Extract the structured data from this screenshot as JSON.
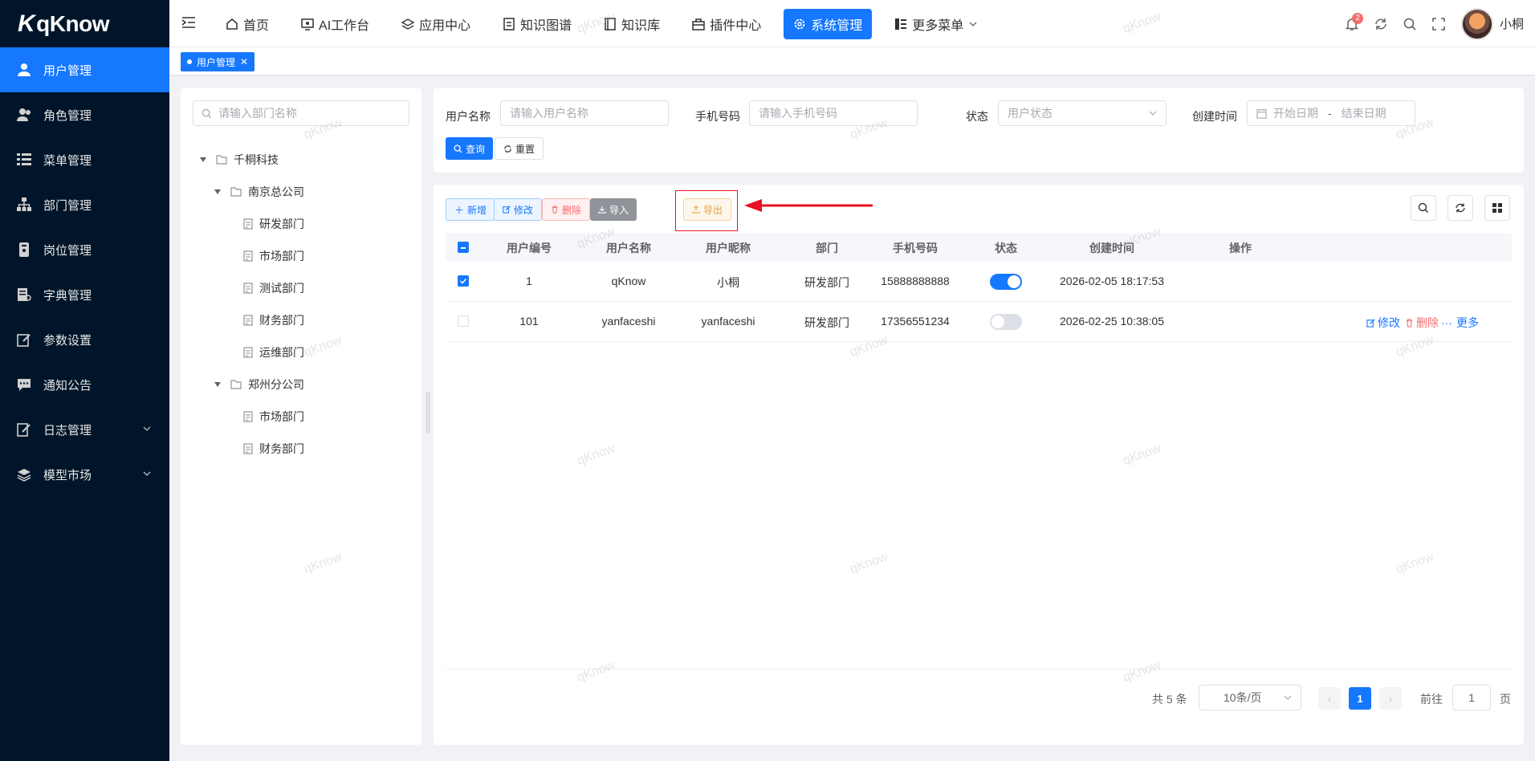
{
  "brand": {
    "name": "qKnow",
    "mark": "K"
  },
  "sidebar": {
    "items": [
      {
        "label": "用户管理",
        "icon": "user-icon",
        "active": true
      },
      {
        "label": "角色管理",
        "icon": "role-icon"
      },
      {
        "label": "菜单管理",
        "icon": "menu-list-icon"
      },
      {
        "label": "部门管理",
        "icon": "org-tree-icon"
      },
      {
        "label": "岗位管理",
        "icon": "post-icon"
      },
      {
        "label": "字典管理",
        "icon": "dictionary-icon"
      },
      {
        "label": "参数设置",
        "icon": "edit-icon"
      },
      {
        "label": "通知公告",
        "icon": "message-icon"
      },
      {
        "label": "日志管理",
        "icon": "log-icon",
        "expandable": true
      },
      {
        "label": "模型市场",
        "icon": "model-icon",
        "expandable": true
      }
    ]
  },
  "topnav": {
    "items": [
      {
        "label": "首页",
        "icon": "home-icon"
      },
      {
        "label": "AI工作台",
        "icon": "monitor-icon"
      },
      {
        "label": "应用中心",
        "icon": "app-icon"
      },
      {
        "label": "知识图谱",
        "icon": "graph-icon"
      },
      {
        "label": "知识库",
        "icon": "book-icon"
      },
      {
        "label": "插件中心",
        "icon": "plugin-icon"
      },
      {
        "label": "系统管理",
        "icon": "gear-icon",
        "active": true
      },
      {
        "label": "更多菜单",
        "icon": "grid-menu-icon"
      }
    ],
    "notification_count": "2",
    "username": "小桐"
  },
  "tabs": {
    "active": "用户管理"
  },
  "tree": {
    "search_placeholder": "请输入部门名称",
    "root": "千桐科技",
    "groups": [
      {
        "label": "南京总公司",
        "children": [
          "研发部门",
          "市场部门",
          "测试部门",
          "财务部门",
          "运维部门"
        ]
      },
      {
        "label": "郑州分公司",
        "children": [
          "市场部门",
          "财务部门"
        ]
      }
    ]
  },
  "search": {
    "username_label": "用户名称",
    "username_placeholder": "请输入用户名称",
    "phone_label": "手机号码",
    "phone_placeholder": "请输入手机号码",
    "status_label": "状态",
    "status_placeholder": "用户状态",
    "created_label": "创建时间",
    "start_placeholder": "开始日期",
    "range_sep": "-",
    "end_placeholder": "结束日期",
    "query_btn": "查询",
    "reset_btn": "重置"
  },
  "toolbar": {
    "add": "新增",
    "edit": "修改",
    "delete": "删除",
    "import": "导入",
    "export": "导出"
  },
  "table": {
    "columns": [
      "用户编号",
      "用户名称",
      "用户昵称",
      "部门",
      "手机号码",
      "状态",
      "创建时间",
      "操作"
    ],
    "rows": [
      {
        "id": "1",
        "username": "qKnow",
        "nickname": "小桐",
        "dept": "研发部门",
        "phone": "15888888888",
        "enabled": true,
        "created": "2026-02-05 18:17:53",
        "checked": true,
        "ops": false
      },
      {
        "id": "101",
        "username": "yanfaceshi",
        "nickname": "yanfaceshi",
        "dept": "研发部门",
        "phone": "17356551234",
        "enabled": false,
        "created": "2026-02-25 10:38:05",
        "checked": false,
        "ops": true
      }
    ],
    "op_edit": "修改",
    "op_delete": "删除",
    "op_more": "更多"
  },
  "pagination": {
    "total_text": "共 5 条",
    "page_size": "10条/页",
    "current_page": "1",
    "jump_prefix": "前往",
    "jump_value": "1",
    "jump_suffix": "页"
  },
  "watermark": "qKnow",
  "colors": {
    "primary": "#1677ff",
    "sidebar_bg": "#001529",
    "danger": "#f56c6c",
    "warning": "#e6a23c",
    "annotation": "#e81123"
  }
}
